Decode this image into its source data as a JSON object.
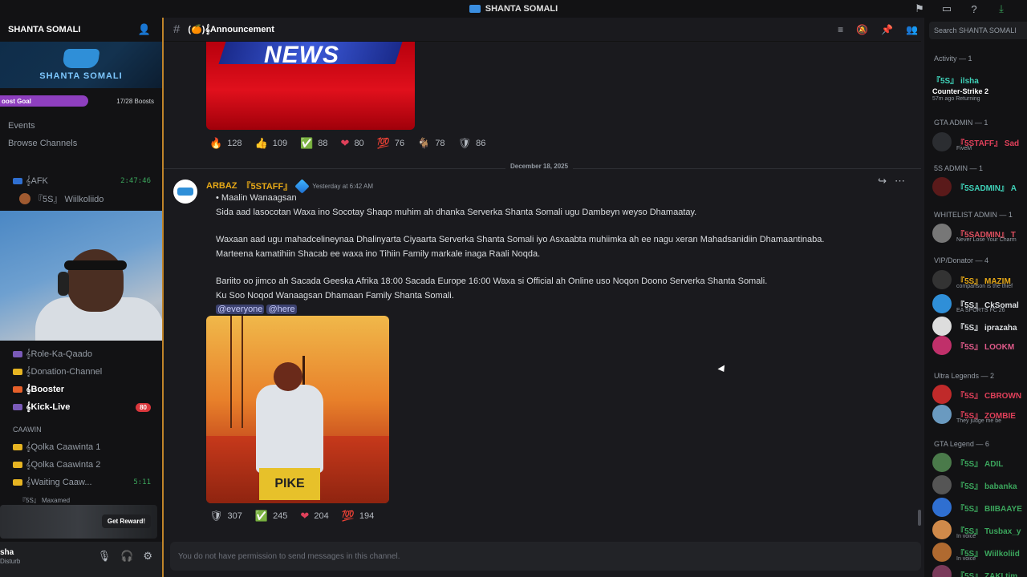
{
  "window": {
    "title": "SHANTA SOMALI"
  },
  "topbar_icons": [
    "flag-icon",
    "screen-icon",
    "help-icon",
    "download-icon"
  ],
  "server": {
    "name": "SHANTA SOMALI",
    "banner_text": "SHANTA SOMALI",
    "boost_goal": "oost Goal",
    "boost_count": "17/28 Boosts",
    "menu": [
      "Events",
      "Browse Channels"
    ]
  },
  "channels": [
    {
      "label": "𝄞AFK",
      "time": "2:47:46"
    },
    {
      "label": "『5S』 Wiilkoliido"
    },
    {
      "label": "𝄞Role-Ka-Qaado"
    },
    {
      "label": "𝄞Donation-Channel"
    },
    {
      "label": "𝄞Booster",
      "bold": true
    },
    {
      "label": "𝄞Kick-Live",
      "bold": true,
      "badge": "80"
    },
    {
      "label": "CAAWIN"
    },
    {
      "label": "𝄞Qolka Caawinta 1"
    },
    {
      "label": "𝄞Qolka Caawinta 2"
    },
    {
      "label": "𝄞Waiting Caaw...",
      "time": "5:11"
    },
    {
      "label": "『5S』 Maxamed"
    }
  ],
  "reward": {
    "button": "Get Reward!"
  },
  "user": {
    "name": "sha",
    "status": "Disturb"
  },
  "channel_header": {
    "name": "(🍊)𝄞Announcement"
  },
  "search_placeholder": "Search SHANTA SOMALI",
  "news_image": {
    "text": "NEWS"
  },
  "reactions_top": [
    {
      "emoji": "🔥",
      "count": "128"
    },
    {
      "emoji": "👍",
      "count": "109"
    },
    {
      "emoji": "✅",
      "count": "88"
    },
    {
      "emoji": "❤",
      "count": "80"
    },
    {
      "emoji": "💯",
      "count": "76"
    },
    {
      "emoji": "🐐",
      "count": "78"
    },
    {
      "emoji": "🛡",
      "count": "86"
    }
  ],
  "date_divider": "December 18, 2025",
  "message": {
    "author": "ARBAZ",
    "tag": "『5STAFF』",
    "timestamp": "Yesterday at 6:42 AM",
    "lines": [
      "• Maalin Wanaagsan",
      "Sida aad lasocotan Waxa ino Socotay Shaqo muhim ah dhanka Serverka Shanta Somali ugu Dambeyn weyso Dhamaatay.",
      "Waxaan aad ugu mahadcelineynaa Dhalinyarta Ciyaarta Serverka Shanta Somali iyo Asxaabta muhiimka ah ee nagu xeran Mahadsanidiin Dhamaantinaba.",
      "Marteena kamatihiin Shacab ee waxa ino Tihiin Family markale inaga Raali Noqda.",
      "Bariito oo jimco ah Sacada Geeska Afrika 18:00 Sacada Europe 16:00 Waxa si Official ah Online uso Noqon Doono Serverka Shanta Somali.",
      "Ku Soo Noqod Wanaagsan Dhamaan Family Shanta Somali."
    ],
    "mention_everyone": "@everyone",
    "mention_here": "@here",
    "image_text": "PIKE"
  },
  "reactions_bottom": [
    {
      "emoji": "🛡",
      "count": "307"
    },
    {
      "emoji": "✅",
      "count": "245"
    },
    {
      "emoji": "❤",
      "count": "204"
    },
    {
      "emoji": "💯",
      "count": "194"
    }
  ],
  "input_placeholder": "You do not have permission to send messages in this channel.",
  "members": {
    "activity_label": "Activity — 1",
    "activity": {
      "name": "『5S』 ilsha",
      "game": "Counter-Strike 2",
      "time": "57m ago",
      "status": "Returning"
    },
    "groups": [
      {
        "label": "GTA ADMIN — 1",
        "members": [
          {
            "name": "『5STAFF』 Sad",
            "sub": "FiveM",
            "color": "#e0405a"
          }
        ]
      },
      {
        "label": "5S ADMIN — 1",
        "members": [
          {
            "name": "『5SADMIN』 A",
            "sub": "",
            "color": "#3fd1b8"
          }
        ]
      },
      {
        "label": "WHITELIST ADMIN — 1",
        "members": [
          {
            "name": "『5SADMIN』 T",
            "sub": "Never Lose Your Charm",
            "color": "#e05060"
          }
        ]
      },
      {
        "label": "VIP/Donator — 4",
        "members": [
          {
            "name": "『5S』 MAZIM",
            "sub": "comparison is the thief",
            "color": "#e6a817"
          },
          {
            "name": "『5S』 CkSomal",
            "sub": "EA SPORTS FC 26",
            "color": "#dbdee1"
          },
          {
            "name": "『5S』 iprazaha",
            "sub": "",
            "color": "#dbdee1"
          },
          {
            "name": "『5S』 LOOKM",
            "sub": "",
            "color": "#e05a8a"
          }
        ]
      },
      {
        "label": "Ultra Legends — 2",
        "members": [
          {
            "name": "『5S』 CBROWN",
            "sub": "",
            "color": "#e0405a"
          },
          {
            "name": "『5S』 ZOMBIE",
            "sub": "They judge me be",
            "color": "#e0405a"
          }
        ]
      },
      {
        "label": "GTA Legend — 6",
        "members": [
          {
            "name": "『5S』 ADIL",
            "sub": "",
            "color": "#3ba55c"
          },
          {
            "name": "『5S』 babanka",
            "sub": "",
            "color": "#3ba55c"
          },
          {
            "name": "『5S』 BIIBAAYE",
            "sub": "",
            "color": "#3ba55c"
          },
          {
            "name": "『5S』 Tusbax_y",
            "sub": "In voice",
            "color": "#3ba55c"
          },
          {
            "name": "『5S』 Wiilkoliid",
            "sub": "In voice",
            "color": "#3ba55c"
          },
          {
            "name": "『5S』 ZAKI tim",
            "sub": "",
            "color": "#3ba55c"
          }
        ]
      }
    ]
  }
}
